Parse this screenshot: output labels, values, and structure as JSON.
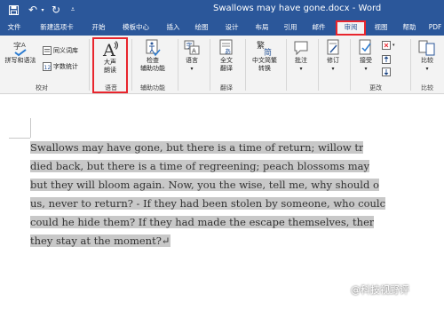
{
  "window": {
    "title": "Swallows may have gone.docx  -  Word"
  },
  "quick_access": {
    "save_icon": "save-icon",
    "undo_icon": "undo-icon",
    "redo_icon": "redo-icon",
    "customize_icon": "customize-icon"
  },
  "tabs": [
    "文件",
    "新建选项卡",
    "开始",
    "模板中心",
    "插入",
    "绘图",
    "设计",
    "布局",
    "引用",
    "邮件",
    "审阅",
    "视图",
    "帮助",
    "PDF"
  ],
  "active_tab": "审阅",
  "ribbon": {
    "proofing": {
      "spelling": "拼写和语法",
      "thesaurus": "同义词库",
      "word_count": "字数统计",
      "label": "校对"
    },
    "speech": {
      "read_aloud_line1": "大声",
      "read_aloud_line2": "朗读",
      "label": "语音"
    },
    "accessibility": {
      "check_line1": "检查",
      "check_line2": "辅助功能",
      "label": "辅助功能"
    },
    "language": {
      "label": "语言"
    },
    "translate": {
      "line1": "全文",
      "line2": "翻译",
      "label": "翻译"
    },
    "chinese_convert": {
      "line1": "中文简繁",
      "line2": "转换"
    },
    "comments": {
      "label": "批注"
    },
    "tracking": {
      "label": "修订"
    },
    "changes": {
      "accept": "接受",
      "label": "更改"
    },
    "compare": {
      "button": "比较",
      "label": "比较"
    }
  },
  "document": {
    "lines": [
      "Swallows may have gone, but there is a time of return; willow tr",
      "died back, but there is a time of regreening; peach blossoms may",
      "but they will bloom again. Now, you the wise, tell me, why should o",
      "us, never to return? - If they had been stolen by someone, who coulc",
      "could he hide them? If they had made the escape themselves, ther",
      "they stay at the moment?↵"
    ]
  },
  "watermark": "@科技视野评"
}
